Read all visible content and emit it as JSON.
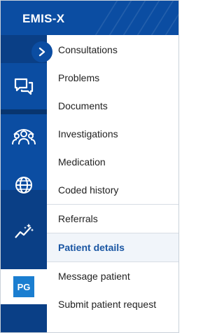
{
  "brand": {
    "logo_text": "EMIS-X",
    "primary_color": "#0b4da2",
    "accent_color": "#1b7ed0"
  },
  "rail": {
    "buttons": [
      {
        "icon": "chat-icon"
      },
      {
        "icon": "patients-group-icon"
      },
      {
        "icon": "globe-icon"
      },
      {
        "icon": "analytics-icon"
      }
    ],
    "patient_badge": "PG",
    "collapse_icon": "chevron-right-icon"
  },
  "menu": {
    "group1": [
      "Consultations",
      "Problems",
      "Documents",
      "Investigations",
      "Medication",
      "Coded history"
    ],
    "group2": [
      "Referrals"
    ],
    "group3_active": "Patient details",
    "group4": [
      "Message patient",
      "Submit patient request"
    ]
  }
}
